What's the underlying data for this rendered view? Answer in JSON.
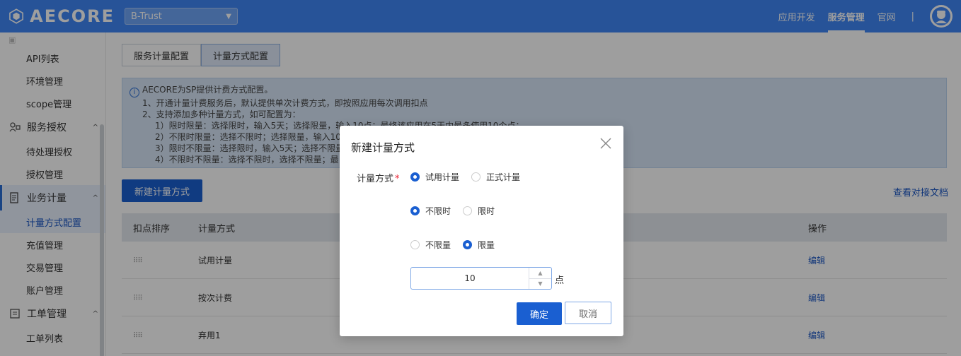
{
  "header": {
    "logo_text": "AECORE",
    "tenant": "B-Trust",
    "nav": [
      "应用开发",
      "服务管理",
      "官网"
    ],
    "nav_active": "服务管理",
    "separator": "|",
    "brand_color": "#3f87f5"
  },
  "sidebar": {
    "top_items": [
      "API列表",
      "环境管理",
      "scope管理"
    ],
    "group_auth": "服务授权",
    "auth_items": [
      "待处理授权",
      "授权管理"
    ],
    "group_metering": "业务计量",
    "metering_items": [
      "计量方式配置",
      "充值管理",
      "交易管理",
      "账户管理"
    ],
    "group_ticket": "工单管理",
    "ticket_items": [
      "工单列表"
    ]
  },
  "main": {
    "tabs": [
      "服务计量配置",
      "计量方式配置"
    ],
    "info_lines": [
      "AECORE为SP提供计费方式配置。",
      "1、开通计量计费服务后，默认提供单次计费方式，即按照应用每次调用扣点",
      "2、支持添加多种计量方式，如可配置为：",
      "1）限时限量：选择限时，输入5天；选择限量，输入10点；最终该应用在5天内最多使用10个点；",
      "2）不限时限量：选择不限时；选择限量，输入10",
      "3）限时不限量：选择限时，输入5天；选择不限量",
      "4）不限时不限量：选择不限时，选择不限量；最"
    ],
    "new_button": "新建计量方式",
    "doc_link": "查看对接文档",
    "table": {
      "headers": [
        "扣点排序",
        "计量方式",
        "操作"
      ],
      "rows": [
        {
          "name": "试用计量",
          "action": "编辑"
        },
        {
          "name": "按次计费",
          "action": "编辑"
        },
        {
          "name": "弃用1",
          "action": "编辑"
        }
      ]
    }
  },
  "modal": {
    "title": "新建计量方式",
    "field_label": "计量方式",
    "required_mark": "*",
    "type_options": [
      "试用计量",
      "正式计量"
    ],
    "type_selected": "试用计量",
    "time_options": [
      "不限时",
      "限时"
    ],
    "time_selected": "不限时",
    "quota_options": [
      "不限量",
      "限量"
    ],
    "quota_selected": "限量",
    "quota_value": "10",
    "quota_unit": "点",
    "ok": "确定",
    "cancel": "取消"
  }
}
